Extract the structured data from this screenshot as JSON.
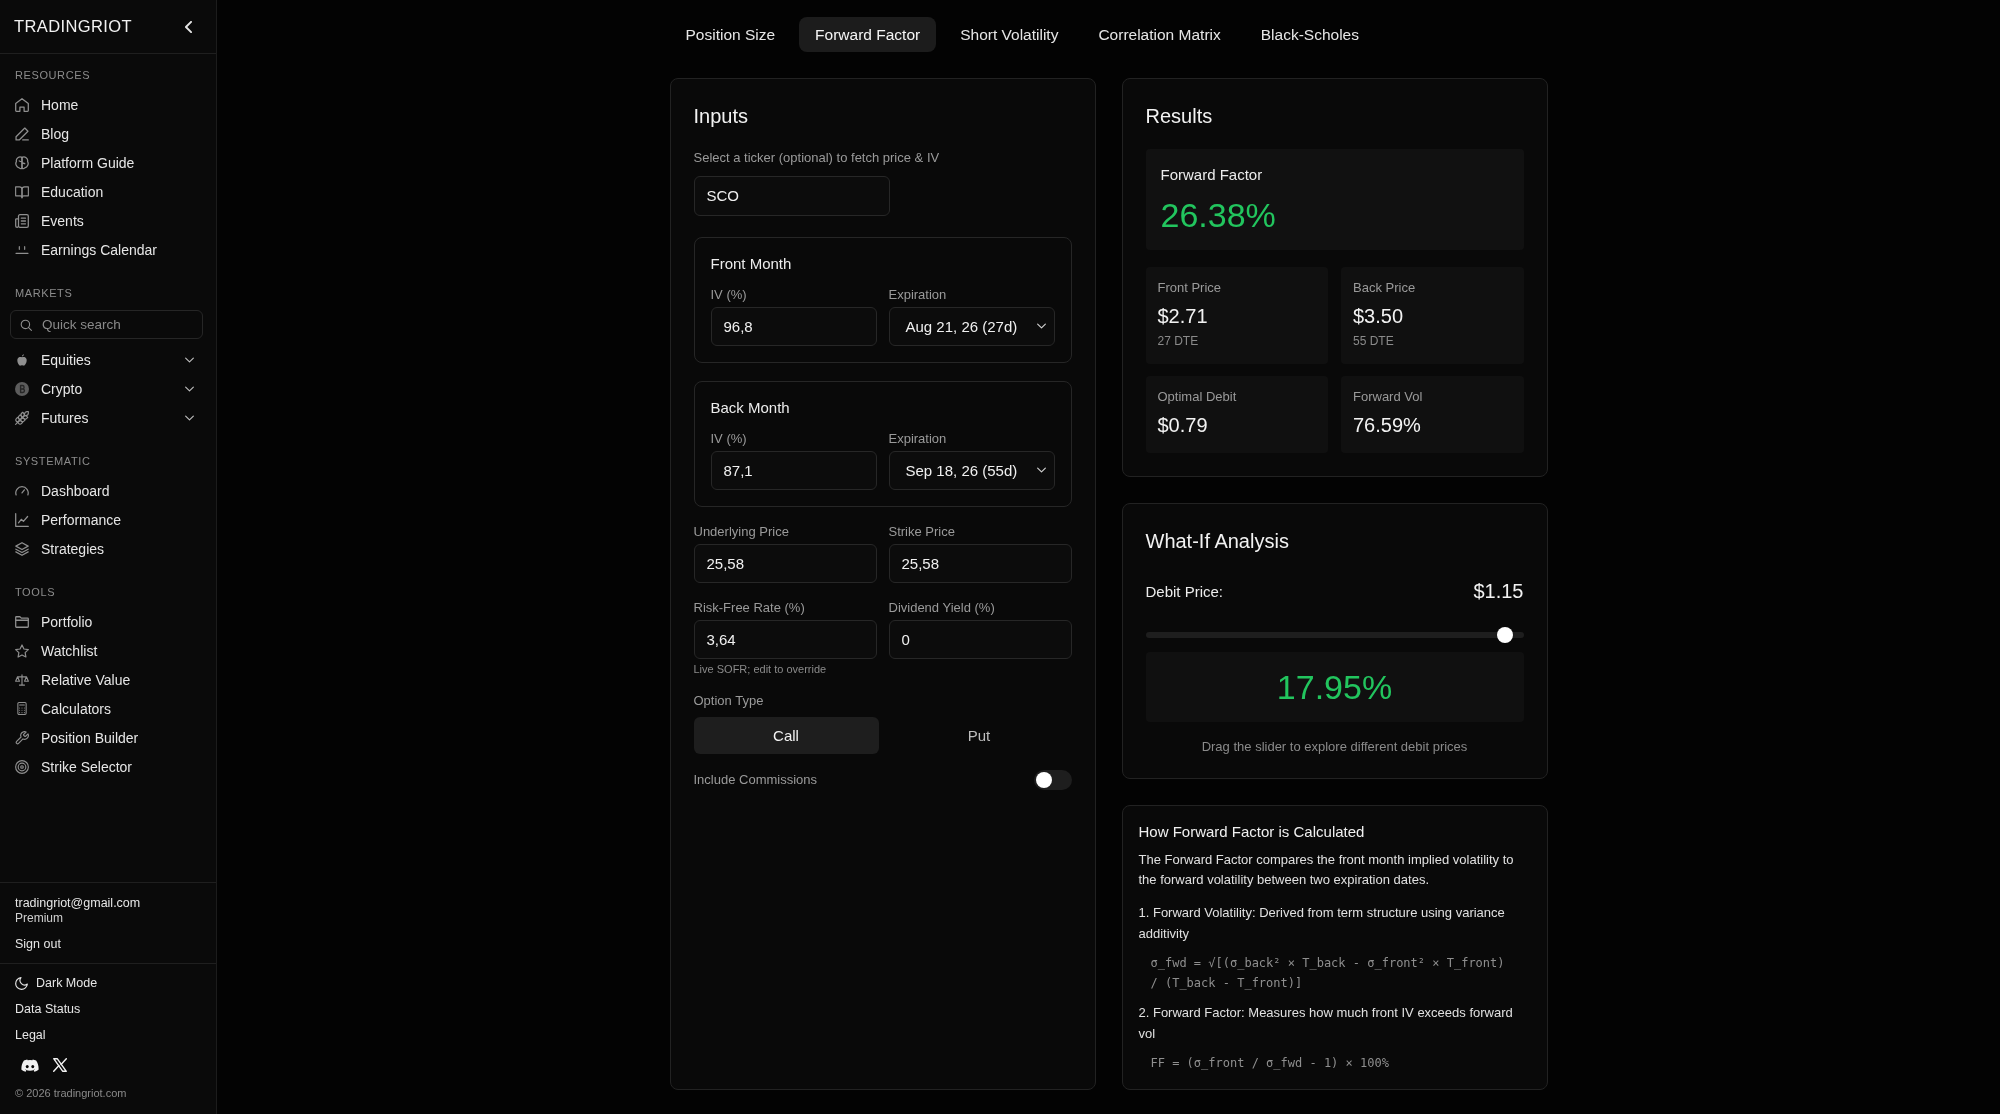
{
  "sidebar": {
    "logo": "TRADINGRIOT",
    "sections": [
      {
        "title": "RESOURCES",
        "items": [
          {
            "label": "Home"
          },
          {
            "label": "Blog"
          },
          {
            "label": "Platform Guide"
          },
          {
            "label": "Education"
          },
          {
            "label": "Events"
          },
          {
            "label": "Earnings Calendar"
          }
        ]
      },
      {
        "title": "MARKETS",
        "search": {
          "placeholder": "Quick search"
        },
        "items": [
          {
            "label": "Equities",
            "expanded": false
          },
          {
            "label": "Crypto",
            "expanded": false
          },
          {
            "label": "Futures",
            "expanded": false
          }
        ]
      },
      {
        "title": "SYSTEMATIC",
        "items": [
          {
            "label": "Dashboard"
          },
          {
            "label": "Performance"
          },
          {
            "label": "Strategies"
          }
        ]
      },
      {
        "title": "TOOLS",
        "items": [
          {
            "label": "Portfolio"
          },
          {
            "label": "Watchlist"
          },
          {
            "label": "Relative Value"
          },
          {
            "label": "Calculators"
          },
          {
            "label": "Position Builder"
          },
          {
            "label": "Strike Selector"
          }
        ]
      }
    ],
    "account": {
      "email": "tradingriot@gmail.com",
      "plan": "Premium",
      "sign_out": "Sign out"
    },
    "footer_links": [
      {
        "label": "Dark Mode",
        "kind": "theme"
      },
      {
        "label": "Data Status",
        "kind": "link"
      },
      {
        "label": "Legal",
        "kind": "link"
      }
    ],
    "copyright": "© 2026 tradingriot.com"
  },
  "tabs": [
    {
      "label": "Position Size",
      "selected": false
    },
    {
      "label": "Forward Factor",
      "selected": true
    },
    {
      "label": "Short Volatility",
      "selected": false
    },
    {
      "label": "Correlation Matrix",
      "selected": false
    },
    {
      "label": "Black-Scholes",
      "selected": false
    }
  ],
  "inputs": {
    "title": "Inputs",
    "ticker": {
      "label": "Select a ticker (optional) to fetch price & IV",
      "value": "SCO"
    },
    "months": [
      {
        "title": "Front Month",
        "iv_label": "IV (%)",
        "iv": "96,8",
        "expiration_label": "Expiration",
        "expiration": "Aug 21, 26 (27d)"
      },
      {
        "title": "Back Month",
        "iv_label": "IV (%)",
        "iv": "87,1",
        "expiration_label": "Expiration",
        "expiration": "Sep 18, 26 (55d)"
      }
    ],
    "fields": [
      {
        "label": "Underlying Price",
        "value": "25,58"
      },
      {
        "label": "Strike Price",
        "value": "25,58"
      },
      {
        "label": "Risk-Free Rate (%)",
        "value": "3,64",
        "note": "Live SOFR; edit to override"
      },
      {
        "label": "Dividend Yield (%)",
        "value": "0"
      }
    ],
    "option_type": {
      "label": "Option Type",
      "options": [
        {
          "label": "Call",
          "selected": true
        },
        {
          "label": "Put",
          "selected": false
        }
      ]
    },
    "commissions": {
      "label": "Include Commissions",
      "on": false
    }
  },
  "results": {
    "title": "Results",
    "headline": {
      "label": "Forward Factor",
      "value": "26.38%"
    },
    "stats": [
      {
        "label": "Front Price",
        "value": "$2.71",
        "sub": "27 DTE"
      },
      {
        "label": "Back Price",
        "value": "$3.50",
        "sub": "55 DTE"
      },
      {
        "label": "Optimal Debit",
        "value": "$0.79"
      },
      {
        "label": "Forward Vol",
        "value": "76.59%"
      }
    ]
  },
  "what_if": {
    "title": "What-If Analysis",
    "debit_label": "Debit Price:",
    "debit_value": "$1.15",
    "slider": {
      "level": 0.95
    },
    "result": "17.95%",
    "caption": "Drag the slider to explore different debit prices"
  },
  "explanation": {
    "title": "How Forward Factor is Calculated",
    "intro": "The Forward Factor compares the front month implied volatility to the forward volatility between two expiration dates.",
    "steps": [
      {
        "text": "1. Forward Volatility: Derived from term structure using variance additivity",
        "formula": "σ_fwd = √[(σ_back² × T_back - σ_front² × T_front) / (T_back - T_front)]"
      },
      {
        "text": "2. Forward Factor: Measures how much front IV exceeds forward vol",
        "formula": "FF = (σ_front / σ_fwd - 1) × 100%"
      }
    ]
  }
}
